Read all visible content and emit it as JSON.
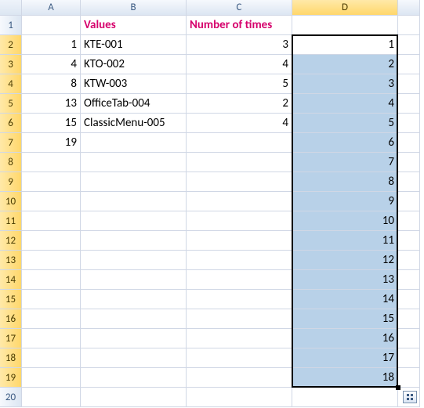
{
  "columns": [
    "A",
    "B",
    "C",
    "D",
    ""
  ],
  "active_col_index": 3,
  "rows": 20,
  "active_row_min": 2,
  "active_row_max": 19,
  "headers_row": {
    "B": "Values",
    "C": "Number of times"
  },
  "colA": {
    "2": "1",
    "3": "4",
    "4": "8",
    "5": "13",
    "6": "15",
    "7": "19"
  },
  "colB": {
    "2": "KTE-001",
    "3": "KTO-002",
    "4": "KTW-003",
    "5": "OfficeTab-004",
    "6": "ClassicMenu-005"
  },
  "colC": {
    "2": "3",
    "3": "4",
    "4": "5",
    "5": "2",
    "6": "4"
  },
  "colD": {
    "2": "1",
    "3": "2",
    "4": "3",
    "5": "4",
    "6": "5",
    "7": "6",
    "8": "7",
    "9": "8",
    "10": "9",
    "11": "10",
    "12": "11",
    "13": "12",
    "14": "13",
    "15": "14",
    "16": "15",
    "17": "16",
    "18": "17",
    "19": "18"
  },
  "selection": {
    "col": "D",
    "row_start": 2,
    "row_end": 19,
    "active_row": 2
  }
}
